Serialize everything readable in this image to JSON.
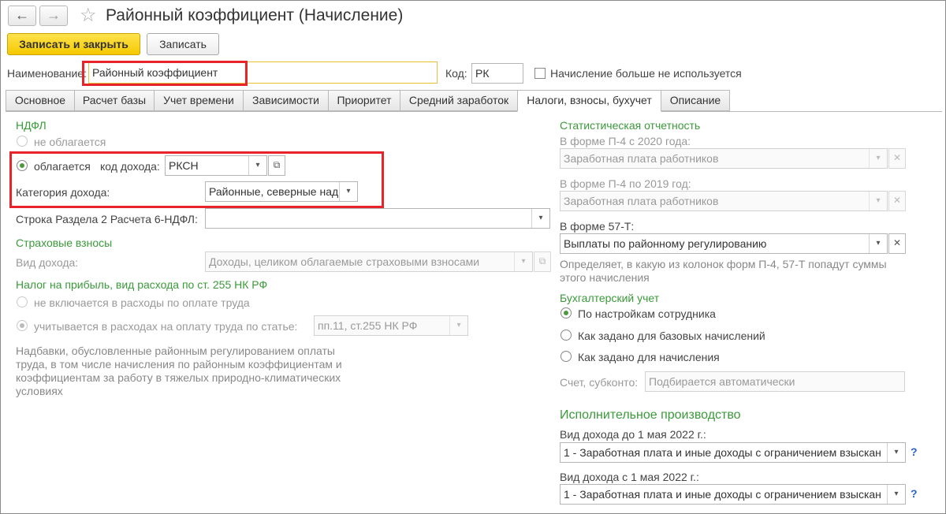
{
  "window": {
    "title": "Районный коэффициент (Начисление)",
    "back_icon": "←",
    "forward_icon": "→",
    "star_icon": "☆"
  },
  "toolbar": {
    "save_close_label": "Записать и закрыть",
    "save_label": "Записать"
  },
  "header": {
    "name_label": "Наименование:",
    "name_value": "Районный коэффициент",
    "code_label": "Код:",
    "code_value": "РК",
    "unused_label": "Начисление больше не используется"
  },
  "tabs": [
    {
      "label": "Основное"
    },
    {
      "label": "Расчет базы"
    },
    {
      "label": "Учет времени"
    },
    {
      "label": "Зависимости"
    },
    {
      "label": "Приоритет"
    },
    {
      "label": "Средний заработок"
    },
    {
      "label": "Налоги, взносы, бухучет"
    },
    {
      "label": "Описание"
    }
  ],
  "ndfl": {
    "heading": "НДФЛ",
    "not_taxed_label": "не облагается",
    "taxed_label": "облагается",
    "income_code_label": "код дохода:",
    "income_code_value": "РКСН",
    "income_category_label": "Категория дохода:",
    "income_category_value": "Районные, северные над",
    "section2_label": "Строка Раздела 2 Расчета 6-НДФЛ:",
    "section2_value": ""
  },
  "insurance": {
    "heading": "Страховые взносы",
    "income_type_label": "Вид дохода:",
    "income_type_value": "Доходы, целиком облагаемые страховыми взносами"
  },
  "profit_tax": {
    "heading": "Налог на прибыль, вид расхода по ст. 255 НК РФ",
    "not_included_label": "не включается в расходы по оплате труда",
    "included_label": "учитывается в расходах на оплату труда по статье:",
    "article_value": "пп.11, ст.255 НК РФ",
    "note_lines": [
      "Надбавки, обусловленные районным регулированием оплаты",
      "труда, в том числе начисления по районным коэффициентам и",
      "коэффициентам за работу в тяжелых природно-климатических",
      "условиях"
    ]
  },
  "stats": {
    "heading": "Статистическая отчетность",
    "p4_2020_label": "В форме П-4 с 2020 года:",
    "p4_2020_value": "Заработная плата работников",
    "p4_2019_label": "В форме П-4 по 2019 год:",
    "p4_2019_value": "Заработная плата работников",
    "f57_label": "В форме 57-Т:",
    "f57_value": "Выплаты по районному регулированию",
    "note_line1": "Определяет, в какую из колонок форм П-4, 57-Т попадут суммы",
    "note_line2": "этого начисления"
  },
  "accounting": {
    "heading": "Бухгалтерский учет",
    "opt1": "По настройкам сотрудника",
    "opt2": "Как задано для базовых начислений",
    "opt3": "Как задано для начисления",
    "account_label": "Счет, субконто:",
    "account_placeholder": "Подбирается автоматически"
  },
  "enforcement": {
    "heading": "Исполнительное производство",
    "before_label": "Вид дохода до 1 мая 2022 г.:",
    "before_value": "1 - Заработная плата и иные доходы с ограничением взыскан",
    "after_label": "Вид дохода с 1 мая 2022 г.:",
    "after_value": "1 - Заработная плата и иные доходы с ограничением взыскан",
    "help_label": "?"
  },
  "icons": {
    "dropdown": "▾",
    "clear": "✕",
    "open": "⧉"
  },
  "colors": {
    "accent_green": "#3a9a3a",
    "primary_button": "#f5c800",
    "highlight_red": "#e8242b"
  }
}
